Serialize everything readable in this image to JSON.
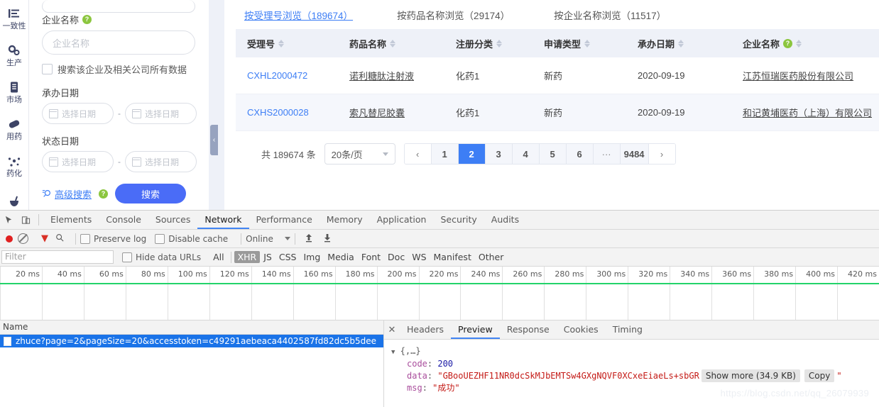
{
  "rail": {
    "items": [
      {
        "label": "一致性",
        "icon": "list-lines-icon"
      },
      {
        "label": "生产",
        "icon": "gears-icon"
      },
      {
        "label": "市场",
        "icon": "document-icon"
      },
      {
        "label": "用药",
        "icon": "capsule-icon"
      },
      {
        "label": "药化",
        "icon": "molecule-icon"
      },
      {
        "label": "",
        "icon": "mortar-icon"
      }
    ]
  },
  "form": {
    "company_label": "企业名称",
    "company_placeholder": "企业名称",
    "checkbox_label": "搜索该企业及相关公司所有数据",
    "handle_date_label": "承办日期",
    "status_date_label": "状态日期",
    "date_placeholder": "选择日期",
    "date_separator": "-",
    "advanced_label": "高级搜索",
    "search_button": "搜索",
    "help_glyph": "?"
  },
  "results": {
    "tabs": [
      {
        "label": "按受理号浏览（189674）",
        "active": true
      },
      {
        "label": "按药品名称浏览（29174）",
        "active": false
      },
      {
        "label": "按企业名称浏览（11517）",
        "active": false
      }
    ],
    "columns": [
      {
        "label": "受理号",
        "help": false
      },
      {
        "label": "药品名称",
        "help": false
      },
      {
        "label": "注册分类",
        "help": false
      },
      {
        "label": "申请类型",
        "help": false
      },
      {
        "label": "承办日期",
        "help": false
      },
      {
        "label": "企业名称",
        "help": true
      }
    ],
    "rows": [
      {
        "accept_no": "CXHL2000472",
        "drug_name": "诺利糖肽注射液",
        "category": "化药1",
        "apply_type": "新药",
        "date": "2020-09-19",
        "company": "江苏恒瑞医药股份有限公司"
      },
      {
        "accept_no": "CXHS2000028",
        "drug_name": "索凡替尼胶囊",
        "category": "化药1",
        "apply_type": "新药",
        "date": "2020-09-19",
        "company": "和记黄埔医药（上海）有限公司"
      }
    ],
    "pagination": {
      "total_text": "共 189674 条",
      "page_size": "20条/页",
      "prev": "‹",
      "next": "›",
      "pages": [
        "1",
        "2",
        "3",
        "4",
        "5",
        "6",
        "···",
        "9484"
      ],
      "current": "2"
    }
  },
  "devtools": {
    "panels": [
      "Elements",
      "Console",
      "Sources",
      "Network",
      "Performance",
      "Memory",
      "Application",
      "Security",
      "Audits"
    ],
    "active_panel": "Network",
    "toolbar": {
      "preserve_log": "Preserve log",
      "disable_cache": "Disable cache",
      "throttling": "Online"
    },
    "filter": {
      "placeholder": "Filter",
      "hide_data_urls": "Hide data URLs",
      "types": [
        "All",
        "XHR",
        "JS",
        "CSS",
        "Img",
        "Media",
        "Font",
        "Doc",
        "WS",
        "Manifest",
        "Other"
      ],
      "active_type": "XHR"
    },
    "timeline_ticks": [
      "20 ms",
      "40 ms",
      "60 ms",
      "80 ms",
      "100 ms",
      "120 ms",
      "140 ms",
      "160 ms",
      "180 ms",
      "200 ms",
      "220 ms",
      "240 ms",
      "260 ms",
      "280 ms",
      "300 ms",
      "320 ms",
      "340 ms",
      "360 ms",
      "380 ms",
      "400 ms",
      "420 ms"
    ],
    "request_list": {
      "header": "Name",
      "selected_request": "zhuce?page=2&pageSize=20&accesstoken=c49291aebeaca4402587fd82dc5b5dee"
    },
    "detail": {
      "tabs": [
        "Headers",
        "Preview",
        "Response",
        "Cookies",
        "Timing"
      ],
      "active_tab": "Preview",
      "root": "{,…}",
      "keys": {
        "code": "code",
        "data": "data",
        "msg": "msg"
      },
      "values": {
        "code": "200",
        "data": "\"GBooUEZHF11NR0dcSkMJbEMTSw4GXgNQVF0XCxeEiaeLs+sbGR",
        "msg": "\"成功\""
      },
      "show_more": "Show more (34.9 KB)",
      "copy": "Copy",
      "close_quote": "\""
    }
  },
  "watermark": "https://blog.csdn.net/qq_26079939",
  "colors": {
    "accent": "#3d7ef5",
    "primary": "#4a6cf7",
    "devtools_accent": "#4285f4",
    "timeline_green": "#23d36a"
  }
}
